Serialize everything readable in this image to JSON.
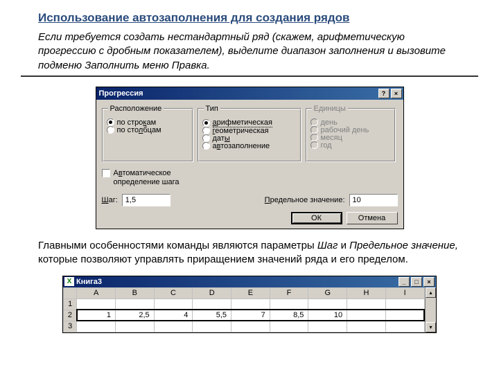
{
  "title": "Использование автозаполнения для создания рядов",
  "intro": "Если требуется создать нестандартный ряд (скажем, арифметическую прогрессию с дробным показателем), выделите диапазон заполнения и вызовите подменю Заполнить меню Правка.",
  "dialog": {
    "caption": "Прогрессия",
    "help_btn": "?",
    "close_btn": "×",
    "groups": {
      "layout": {
        "legend": "Расположение",
        "opt_rows_pre": "по стро",
        "opt_rows_u": "к",
        "opt_rows_post": "ам",
        "opt_cols_pre": "по сто",
        "opt_cols_u": "л",
        "opt_cols_post": "бцам"
      },
      "type": {
        "legend": "Тип",
        "o1_u": "а",
        "o1_post": "рифметическая",
        "o2_u": "г",
        "o2_post": "еометрическая",
        "o3_pre": "дат",
        "o3_u": "ы",
        "o4_pre": "а",
        "o4_u": "в",
        "o4_post": "тозаполнение"
      },
      "units": {
        "legend": "Единицы",
        "o1": "день",
        "o2": "рабочий день",
        "o3": "месяц",
        "o4": "год"
      }
    },
    "autostep_pre": "А",
    "autostep_u": "в",
    "autostep_post": "томатическое определение шага",
    "step_label_u": "Ш",
    "step_label_post": "аг:",
    "step_value": "1,5",
    "limit_label_u": "П",
    "limit_label_post": "редельное значение:",
    "limit_value": "10",
    "ok": "ОК",
    "cancel": "Отмена"
  },
  "desc_parts": {
    "p1": "Главными особенностями команды являются параметры ",
    "i1": "Шаг",
    "p2": " и ",
    "i2": "Предельное значение,",
    "p3": " которые позволяют управлять приращением значений ряда и его пределом."
  },
  "sheet": {
    "title": "Книга3",
    "cols": [
      "A",
      "B",
      "C",
      "D",
      "E",
      "F",
      "G",
      "H",
      "I"
    ],
    "rows": [
      "1",
      "2",
      "3"
    ],
    "values": [
      "1",
      "2,5",
      "4",
      "5,5",
      "7",
      "8,5",
      "10",
      "",
      ""
    ],
    "up": "▴",
    "dn": "▾",
    "lf": "◂",
    "min": "_",
    "max": "□",
    "close": "×"
  }
}
